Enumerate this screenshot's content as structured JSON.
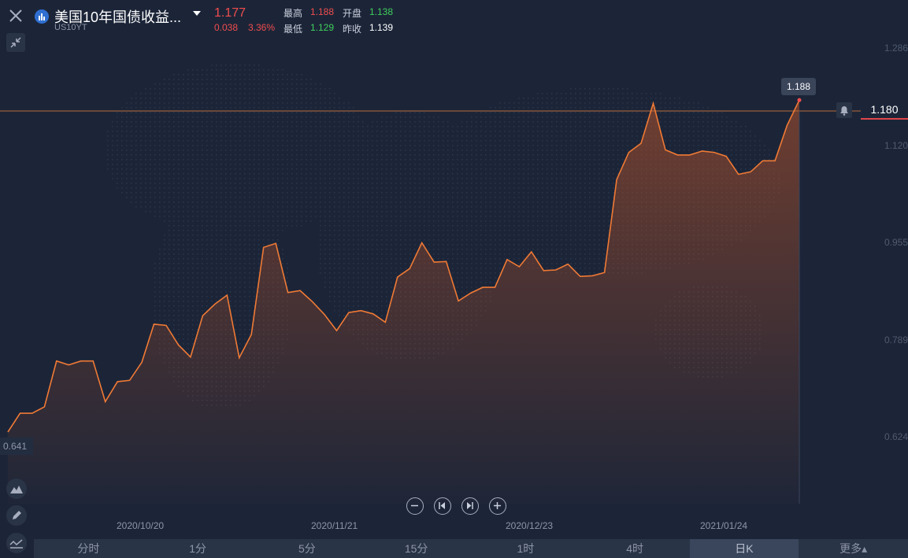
{
  "header": {
    "title": "美国10年国债收益...",
    "code": "US10YT",
    "price": "1.177",
    "change": "0.038",
    "change_pct": "3.36%",
    "high_label": "最高",
    "high": "1.188",
    "open_label": "开盘",
    "open": "1.138",
    "low_label": "最低",
    "low": "1.129",
    "prev_label": "昨收",
    "prev_close": "1.139"
  },
  "chart_markers": {
    "hover_value": "1.188",
    "last_value": "1.180",
    "min_value": "0.641"
  },
  "timeframe_tabs": [
    "分时",
    "1分",
    "5分",
    "15分",
    "1时",
    "4时",
    "日K",
    "更多▴"
  ],
  "active_tab": "日K",
  "colors": {
    "background": "#1c2538",
    "line": "#f07a35",
    "up": "#f04d4d",
    "down": "#3fcf5c",
    "price_line": "#b86a3a"
  },
  "chart_data": {
    "type": "area",
    "y_ticks": [
      "1.286",
      "1.120",
      "0.955",
      "0.789",
      "0.624"
    ],
    "y_tick_values": [
      1.286,
      1.12,
      0.955,
      0.789,
      0.624
    ],
    "ylim": [
      0.555,
      1.335
    ],
    "x_ticks": [
      {
        "label": "2020/10/20",
        "index": 10
      },
      {
        "label": "2020/11/21",
        "index": 32
      },
      {
        "label": "2020/12/23",
        "index": 54
      },
      {
        "label": "2021/01/24",
        "index": 76
      }
    ],
    "values": [
      0.666,
      0.695,
      0.695,
      0.705,
      0.776,
      0.77,
      0.776,
      0.776,
      0.713,
      0.744,
      0.746,
      0.774,
      0.833,
      0.831,
      0.801,
      0.782,
      0.846,
      0.864,
      0.878,
      0.781,
      0.817,
      0.952,
      0.958,
      0.882,
      0.885,
      0.868,
      0.848,
      0.823,
      0.851,
      0.854,
      0.849,
      0.836,
      0.906,
      0.919,
      0.959,
      0.929,
      0.93,
      0.869,
      0.881,
      0.89,
      0.89,
      0.933,
      0.922,
      0.945,
      0.916,
      0.917,
      0.926,
      0.907,
      0.908,
      0.913,
      1.057,
      1.099,
      1.113,
      1.175,
      1.103,
      1.095,
      1.095,
      1.101,
      1.099,
      1.093,
      1.065,
      1.069,
      1.086,
      1.086,
      1.141,
      1.18
    ]
  }
}
